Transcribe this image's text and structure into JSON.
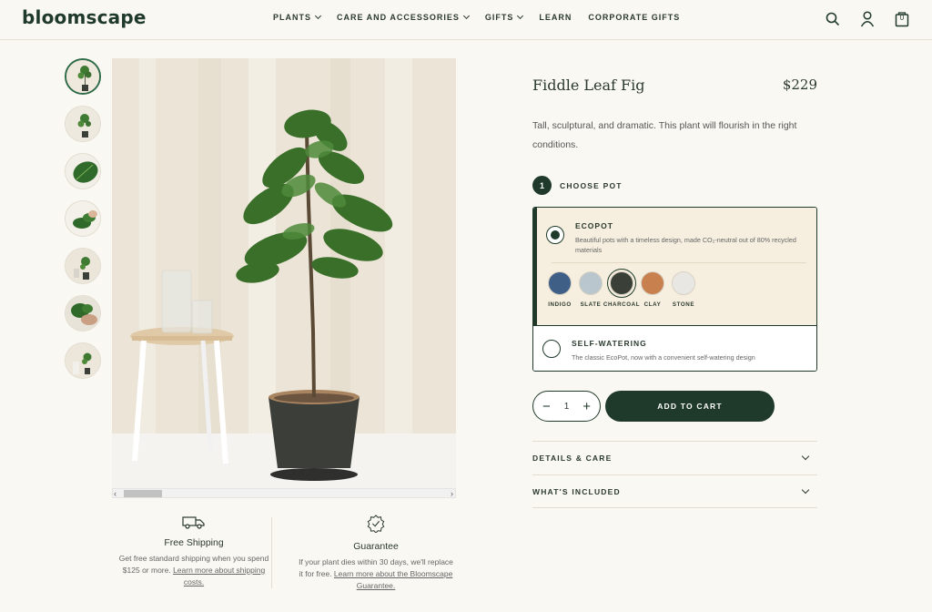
{
  "header": {
    "logo": "bloomscape",
    "nav": [
      {
        "label": "PLANTS"
      },
      {
        "label": "CARE AND ACCESSORIES"
      },
      {
        "label": "GIFTS"
      },
      {
        "label": "LEARN"
      },
      {
        "label": "CORPORATE GIFTS"
      }
    ],
    "icons": [
      "search-icon",
      "account-icon",
      "cart-icon"
    ],
    "cart_count": "0"
  },
  "gallery": {
    "thumbnail_count": 7,
    "active_index": 0
  },
  "product": {
    "title": "Fiddle Leaf Fig",
    "price": "$229",
    "description": "Tall, sculptural, and dramatic. This plant will flourish in the right conditions.",
    "step_number": "1",
    "step_label": "CHOOSE POT",
    "pot_options": [
      {
        "title": "ECOPOT",
        "description": "Beautiful pots with a timeless design, made CO₂-neutral out of 80% recycled materials",
        "selected": true
      },
      {
        "title": "SELF-WATERING",
        "description": "The classic EcoPot, now with a convenient self-watering design",
        "selected": false
      }
    ],
    "colors": [
      {
        "label": "INDIGO",
        "hex": "#3f5f87"
      },
      {
        "label": "SLATE",
        "hex": "#b9c6cd"
      },
      {
        "label": "CHARCOAL",
        "hex": "#3a3f37"
      },
      {
        "label": "CLAY",
        "hex": "#c9804f"
      },
      {
        "label": "STONE",
        "hex": "#e8e7e3"
      }
    ],
    "selected_color": "CHARCOAL",
    "quantity": "1",
    "add_to_cart": "ADD TO CART",
    "accordion": [
      "DETAILS & CARE",
      "WHAT'S INCLUDED"
    ]
  },
  "info": {
    "shipping": {
      "title": "Free Shipping",
      "text": "Get free standard shipping when you spend $125 or more. ",
      "link": "Learn more about shipping costs."
    },
    "guarantee": {
      "title": "Guarantee",
      "text": "If your plant dies within 30 days, we'll replace it for free. ",
      "link": "Learn more about the Bloomscape Guarantee."
    }
  },
  "colors": {
    "brand_green": "#1f3a2a",
    "background": "#faf8f2",
    "selected_option_bg": "#f6efdf"
  }
}
